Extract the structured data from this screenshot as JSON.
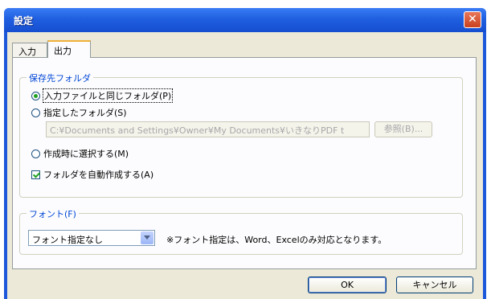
{
  "window": {
    "title": "設定"
  },
  "tabs": [
    {
      "label": "入力"
    },
    {
      "label": "出力"
    }
  ],
  "save_folder": {
    "legend": "保存先フォルダ",
    "options": [
      {
        "label": "入力ファイルと同じフォルダ(P)",
        "selected": true
      },
      {
        "label": "指定したフォルダ(S)",
        "selected": false
      },
      {
        "label": "作成時に選択する(M)",
        "selected": false
      }
    ],
    "path_value": "C:¥Documents and Settings¥Owner¥My Documents¥いきなりPDF t",
    "browse_label": "参照(B)...",
    "auto_create_label": "フォルダを自動作成する(A)",
    "auto_create_checked": true
  },
  "font": {
    "legend": "フォント(F)",
    "selected": "フォント指定なし",
    "note": "※フォント指定は、Word、Excelのみ対応となります。"
  },
  "buttons": {
    "ok": "OK",
    "cancel": "キャンセル"
  },
  "colors": {
    "titlebar": "#1f5fe0",
    "legend_text": "#0046d5",
    "face": "#ece9d8"
  }
}
